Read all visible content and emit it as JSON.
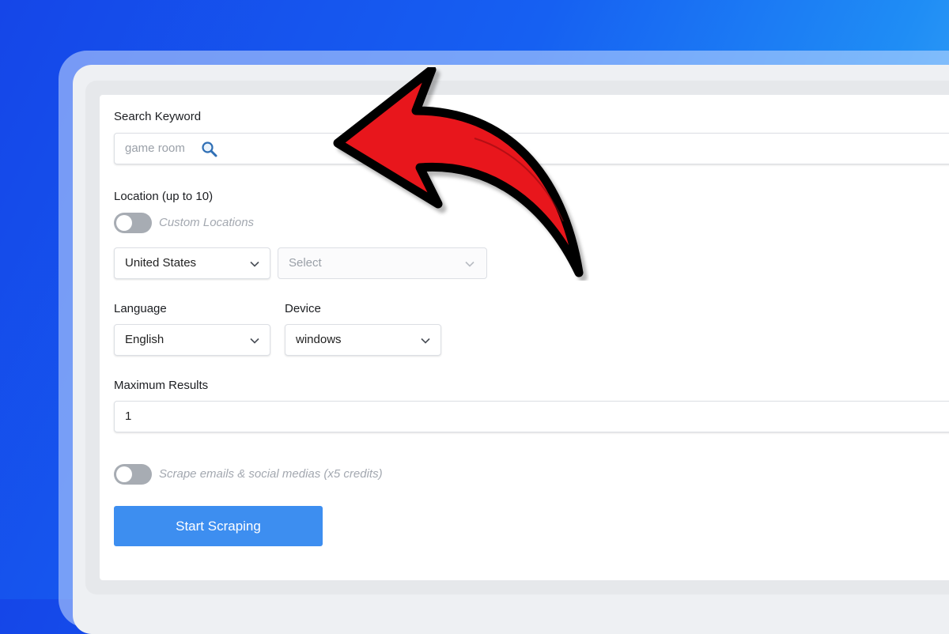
{
  "form": {
    "keyword": {
      "label": "Search Keyword",
      "value": "game room",
      "icon": "search-icon"
    },
    "location": {
      "label": "Location (up to 10)",
      "custom_toggle_label": "Custom Locations",
      "custom_toggle_on": false,
      "country_value": "United States",
      "region_placeholder": "Select"
    },
    "language": {
      "label": "Language",
      "value": "English"
    },
    "device": {
      "label": "Device",
      "value": "windows"
    },
    "max_results": {
      "label": "Maximum Results",
      "value": "1"
    },
    "scrape_toggle": {
      "label": "Scrape emails & social medias (x5 credits)",
      "on": false
    },
    "submit_label": "Start Scraping"
  },
  "colors": {
    "accent": "#3d8ef0",
    "arrow": "#e8141b",
    "background_start": "#1546e8",
    "background_end": "#4fb6f7"
  }
}
